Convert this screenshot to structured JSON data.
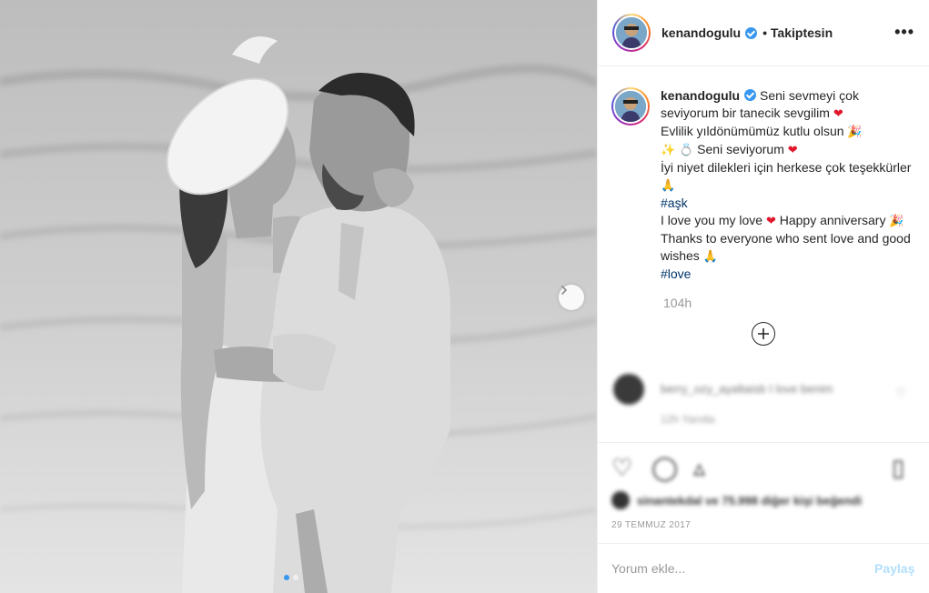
{
  "post": {
    "username": "kenandogulu",
    "follow_state": "• Takiptesin",
    "more_label": "•••",
    "caption": {
      "username": "kenandogulu",
      "line1": "Seni sevmeyi çok seviyorum bir tanecik sevgilim",
      "line2": "Evlilik yıldönümümüz kutlu olsun",
      "line3": "Seni seviyorum",
      "line4": "İyi niyet dilekleri için herkese çok teşekkürler",
      "hashtag1": "#aşk",
      "line5": "I love you my love",
      "line6": "Happy anniversary",
      "line7": "Thanks to everyone who sent love and good wishes",
      "hashtag2": "#love"
    },
    "time_ago": "104h",
    "comment": {
      "text": "berry_ozy_ayaltaisb I love benim",
      "meta": "12h   Yanıtla"
    },
    "likes_text": "sinantekdal ve 75.998 diğer kişi beğendi",
    "date": "29 TEMMUZ 2017",
    "comment_placeholder": "Yorum ekle...",
    "post_button": "Paylaş"
  },
  "colors": {
    "accent": "#3897f0",
    "hashtag": "#003569",
    "heart": "#e0162b",
    "muted": "#999999"
  },
  "icons": [
    "verified-badge-icon",
    "more-options-icon",
    "next-arrow-icon",
    "plus-circle-icon",
    "heart-icon",
    "comment-icon",
    "share-icon",
    "bookmark-icon"
  ]
}
